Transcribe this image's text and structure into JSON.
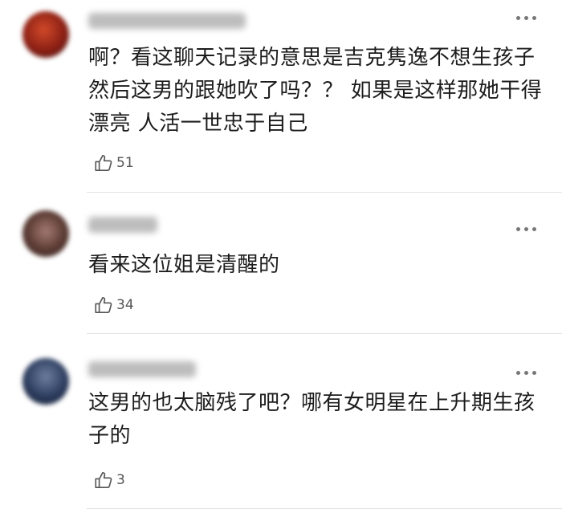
{
  "comments": [
    {
      "text": "啊？看这聊天记录的意思是吉克隽逸不想生孩子 然后这男的跟她吹了吗？？ 如果是这样那她干得漂亮 人活一世忠于自己",
      "likes": "51"
    },
    {
      "text": "看来这位姐是清醒的",
      "likes": "34"
    },
    {
      "text": "这男的也太脑残了吧？哪有女明星在上升期生孩子的",
      "likes": "3"
    }
  ],
  "icons": {
    "like": "thumbs-up-icon",
    "more": "more-options-icon"
  },
  "colors": {
    "text": "#1c1c1c",
    "meta": "#555555",
    "divider": "#e3e3e3"
  }
}
